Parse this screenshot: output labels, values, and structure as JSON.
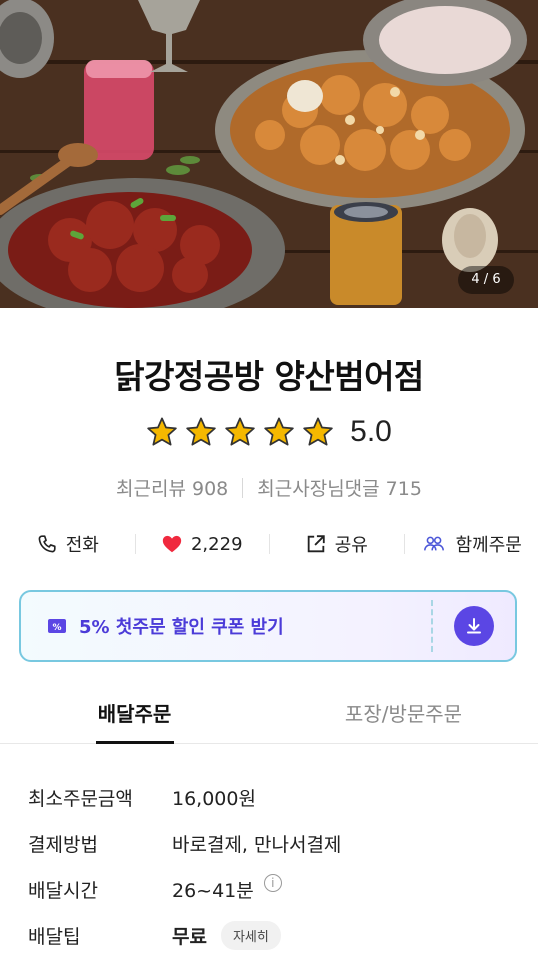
{
  "hero": {
    "counter": "4 / 6"
  },
  "store": {
    "name": "닭강정공방 양산범어점",
    "rating": 5.0,
    "rating_text": "5.0",
    "stars_filled": 5,
    "recent_reviews": "최근리뷰 908",
    "recent_owner_replies": "최근사장님댓글 715"
  },
  "actions": {
    "call": "전화",
    "likes": "2,229",
    "share": "공유",
    "group_order": "함께주문"
  },
  "coupon": {
    "label": "5% 첫주문 할인 쿠폰 받기",
    "accent": "#5b46e4"
  },
  "tabs": {
    "delivery": "배달주문",
    "pickup": "포장/방문주문"
  },
  "info": {
    "min_order_label": "최소주문금액",
    "min_order_value": "16,000원",
    "payment_label": "결제방법",
    "payment_value": "바로결제, 만나서결제",
    "delivery_time_label": "배달시간",
    "delivery_time_value": "26~41분",
    "delivery_tip_label": "배달팁",
    "delivery_tip_value": "무료",
    "detail_button": "자세히"
  },
  "colors": {
    "heart": "#f0293e",
    "star": "#f5b800",
    "coupon_border": "#78c8e0"
  }
}
